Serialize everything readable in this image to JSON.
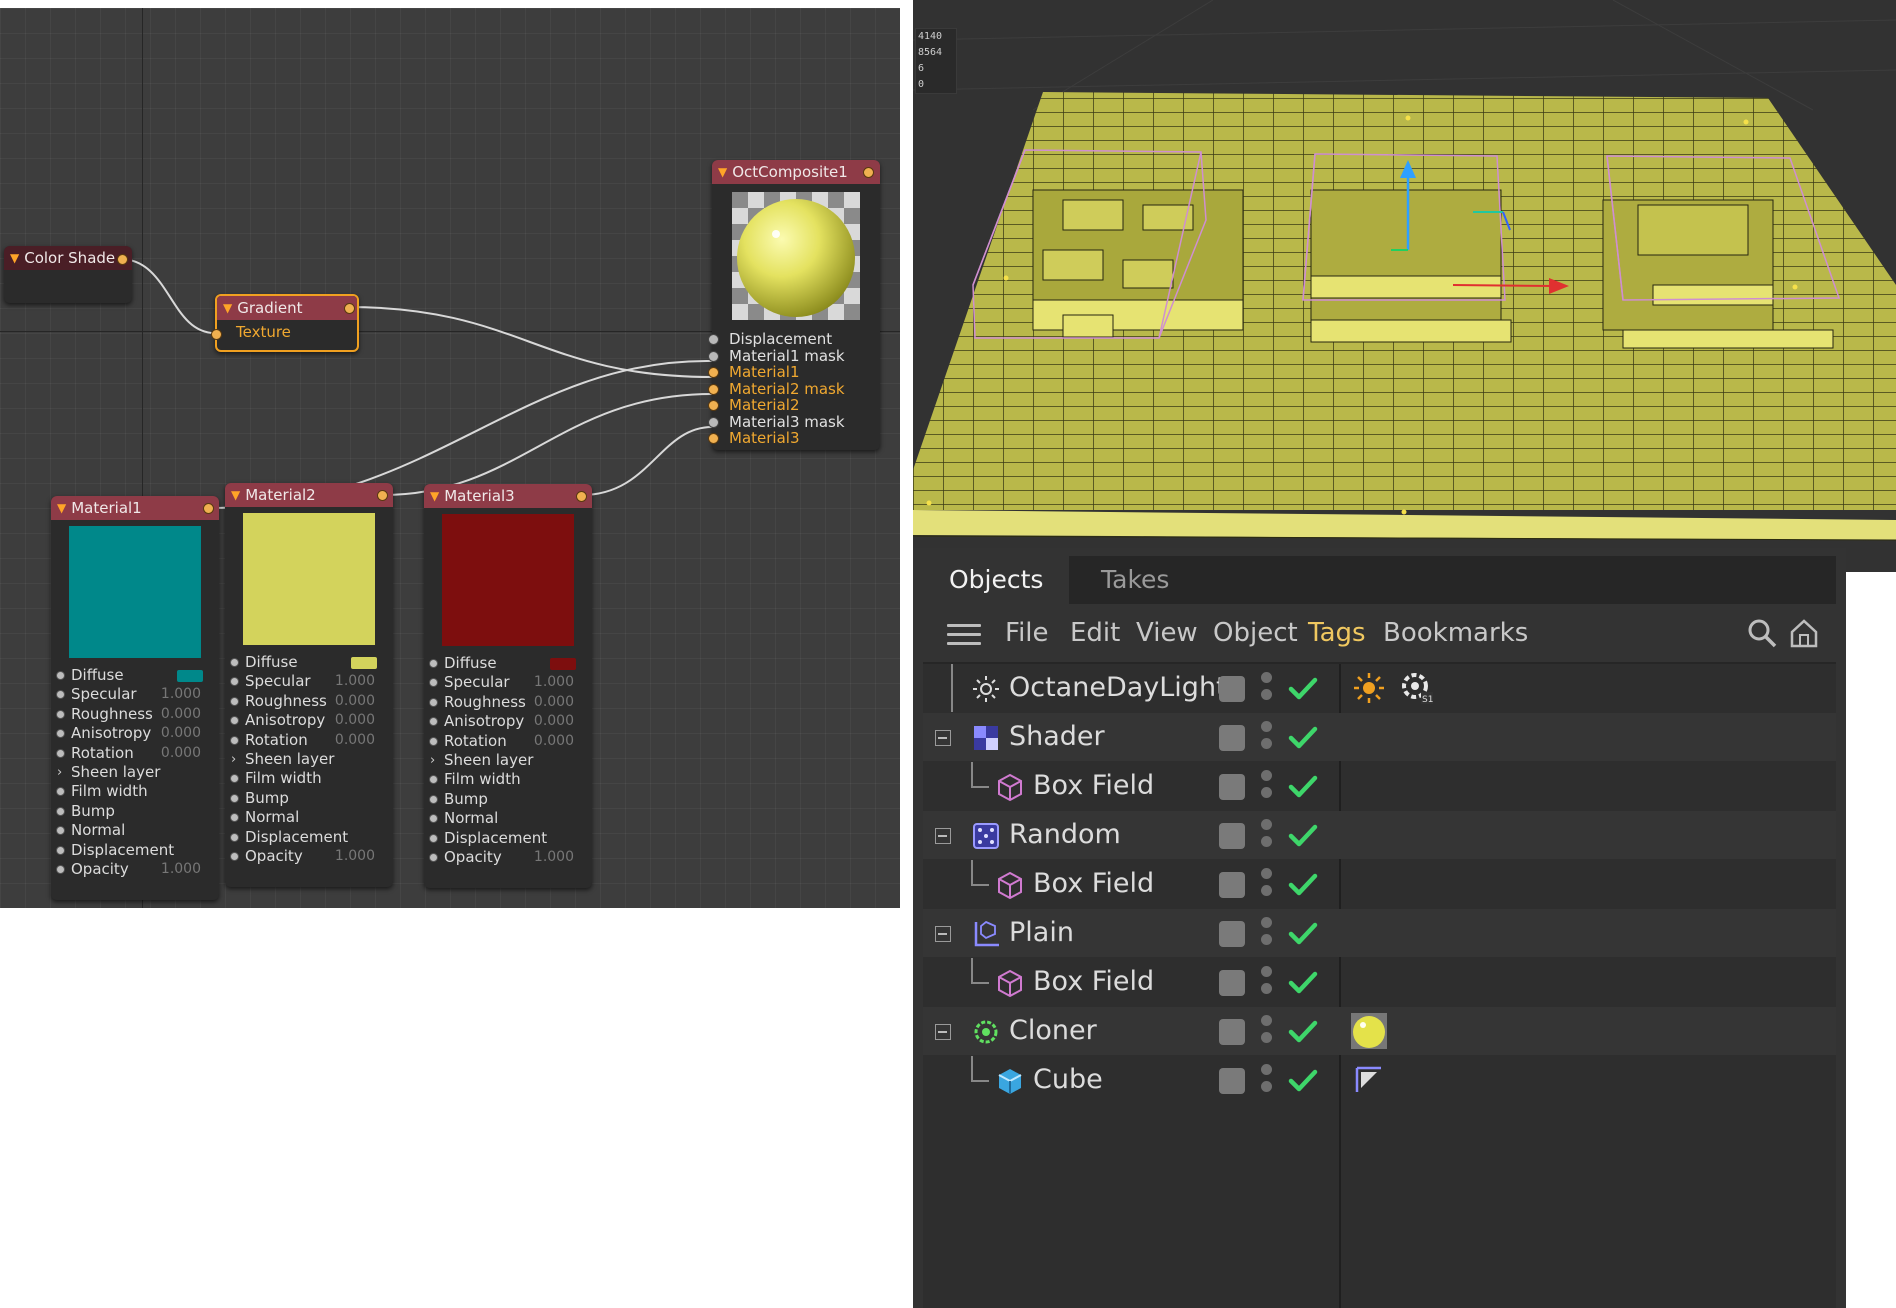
{
  "node_editor": {
    "nodes": {
      "color_shade": {
        "title": "Color Shade"
      },
      "gradient": {
        "title": "Gradient",
        "input": "Texture"
      },
      "composite": {
        "title": "OctComposite1",
        "inputs": [
          "Displacement",
          "Material1 mask",
          "Material1",
          "Material2 mask",
          "Material2",
          "Material3 mask",
          "Material3"
        ]
      },
      "material1": {
        "title": "Material1",
        "diffuse_color": "#00888a",
        "rows": [
          {
            "label": "Diffuse",
            "value": ""
          },
          {
            "label": "Specular",
            "value": "1.000"
          },
          {
            "label": "Roughness",
            "value": "0.000"
          },
          {
            "label": "Anisotropy",
            "value": "0.000"
          },
          {
            "label": "Rotation",
            "value": "0.000"
          },
          {
            "label": "Sheen layer",
            "value": ""
          },
          {
            "label": "Film width",
            "value": ""
          },
          {
            "label": "Bump",
            "value": ""
          },
          {
            "label": "Normal",
            "value": ""
          },
          {
            "label": "Displacement",
            "value": ""
          },
          {
            "label": "Opacity",
            "value": "1.000"
          }
        ]
      },
      "material2": {
        "title": "Material2",
        "diffuse_color": "#d3d35c",
        "rows": [
          {
            "label": "Diffuse",
            "value": ""
          },
          {
            "label": "Specular",
            "value": "1.000"
          },
          {
            "label": "Roughness",
            "value": "0.000"
          },
          {
            "label": "Anisotropy",
            "value": "0.000"
          },
          {
            "label": "Rotation",
            "value": "0.000"
          },
          {
            "label": "Sheen layer",
            "value": ""
          },
          {
            "label": "Film width",
            "value": ""
          },
          {
            "label": "Bump",
            "value": ""
          },
          {
            "label": "Normal",
            "value": ""
          },
          {
            "label": "Displacement",
            "value": ""
          },
          {
            "label": "Opacity",
            "value": "1.000"
          }
        ]
      },
      "material3": {
        "title": "Material3",
        "diffuse_color": "#7d0e0e",
        "rows": [
          {
            "label": "Diffuse",
            "value": ""
          },
          {
            "label": "Specular",
            "value": "1.000"
          },
          {
            "label": "Roughness",
            "value": "0.000"
          },
          {
            "label": "Anisotropy",
            "value": "0.000"
          },
          {
            "label": "Rotation",
            "value": "0.000"
          },
          {
            "label": "Sheen layer",
            "value": ""
          },
          {
            "label": "Film width",
            "value": ""
          },
          {
            "label": "Bump",
            "value": ""
          },
          {
            "label": "Normal",
            "value": ""
          },
          {
            "label": "Displacement",
            "value": ""
          },
          {
            "label": "Opacity",
            "value": "1.000"
          }
        ]
      }
    }
  },
  "viewport": {
    "hud": [
      "4140",
      "8564",
      "6",
      "0"
    ],
    "object_color": "#c4c24e"
  },
  "objects_panel": {
    "tabs": [
      "Objects",
      "Takes"
    ],
    "menu": [
      "File",
      "Edit",
      "View",
      "Object",
      "Tags",
      "Bookmarks"
    ],
    "objects": [
      {
        "name": "OctaneDayLight",
        "icon": "daylight-icon",
        "tags": [
          "sun-tag-icon",
          "octane-settings-tag-icon"
        ]
      },
      {
        "name": "Shader",
        "icon": "shader-field-icon",
        "tags": []
      },
      {
        "name": "Box Field",
        "icon": "box-field-icon",
        "tags": []
      },
      {
        "name": "Random",
        "icon": "random-field-icon",
        "tags": []
      },
      {
        "name": "Box Field",
        "icon": "box-field-icon",
        "tags": []
      },
      {
        "name": "Plain",
        "icon": "plain-effector-icon",
        "tags": []
      },
      {
        "name": "Box Field",
        "icon": "box-field-icon",
        "tags": []
      },
      {
        "name": "Cloner",
        "icon": "cloner-icon",
        "tags": [
          "material-tag-icon"
        ]
      },
      {
        "name": "Cube",
        "icon": "cube-icon",
        "tags": [
          "phong-tag-icon"
        ]
      }
    ]
  }
}
